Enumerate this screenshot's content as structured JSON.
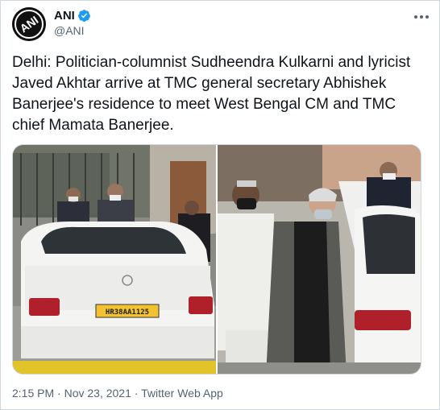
{
  "author": {
    "display_name": "ANI",
    "handle": "@ANI",
    "avatar_text": "ANI",
    "verified": true
  },
  "tweet": {
    "text": "Delhi: Politician-columnist Sudheendra Kulkarni and lyricist Javed Akhtar arrive at TMC general secretary Abhishek Banerjee's residence to meet West Bengal CM and TMC chief Mamata Banerjee."
  },
  "media": {
    "photos": [
      {
        "name": "white Mercedes car with number plate arriving at residence gate",
        "plate_text": "HR38AA1125"
      },
      {
        "name": "Javed Akhtar and Sudheendra Kulkarni walking beside white car"
      }
    ]
  },
  "meta": {
    "time": "2:15 PM",
    "date": "Nov 23, 2021",
    "source": "Twitter Web App",
    "separator": "·"
  },
  "colors": {
    "verified_blue": "#1d9bf0",
    "text_primary": "#0f1419",
    "text_secondary": "#536471",
    "border": "#cfd9de"
  },
  "icons": {
    "more": "more-horizontal-icon",
    "verified": "verified-badge-icon"
  }
}
